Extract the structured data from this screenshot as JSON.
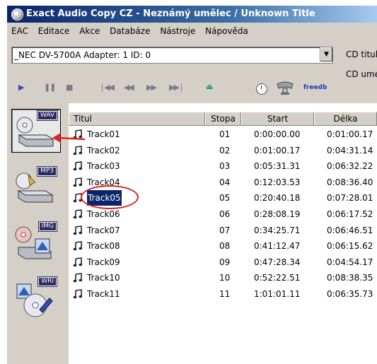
{
  "window": {
    "title": "Exact Audio Copy CZ  -  Neznámý umělec / Unknown Title",
    "icon": "cd-icon"
  },
  "menu": {
    "items": [
      "EAC",
      "Editace",
      "Akce",
      "Databáze",
      "Nástroje",
      "Nápověda"
    ]
  },
  "drive": {
    "selected": "_NEC   DV-5700A  Adapter: 1  ID: 0"
  },
  "cd_info": {
    "title_label": "CD titul",
    "artist_label": "CD ume"
  },
  "toolbar": {
    "buttons": [
      "play-icon",
      "pause-icon",
      "stop-icon",
      "skip-back-icon",
      "rewind-icon",
      "fast-forward-icon",
      "skip-forward-icon",
      "eject-icon",
      "clock-icon",
      "network-drive-icon",
      "freedb-icon"
    ],
    "freedb_label": "freedb"
  },
  "left_panel": {
    "buttons": [
      {
        "label": "WAV",
        "icon": "cd-to-hdd-wav-icon",
        "active": true
      },
      {
        "label": "MP3",
        "icon": "cd-to-hdd-mp3-icon",
        "active": false
      },
      {
        "label": "IMG",
        "icon": "cd-image-icon",
        "active": false
      },
      {
        "label": "WRI",
        "icon": "cd-write-icon",
        "active": false
      }
    ]
  },
  "table": {
    "columns": [
      "Titul",
      "Stopa",
      "Start",
      "Délka"
    ],
    "rows": [
      {
        "title": "Track01",
        "track": "01",
        "start": "0:00:00.00",
        "length": "0:01:00.17"
      },
      {
        "title": "Track02",
        "track": "02",
        "start": "0:01:00.17",
        "length": "0:04:31.14"
      },
      {
        "title": "Track03",
        "track": "03",
        "start": "0:05:31.31",
        "length": "0:06:32.22"
      },
      {
        "title": "Track04",
        "track": "04",
        "start": "0:12:03.53",
        "length": "0:08:36.40"
      },
      {
        "title": "Track05",
        "track": "05",
        "start": "0:20:40.18",
        "length": "0:07:28.01"
      },
      {
        "title": "Track06",
        "track": "06",
        "start": "0:28:08.19",
        "length": "0:06:17.52"
      },
      {
        "title": "Track07",
        "track": "07",
        "start": "0:34:25.71",
        "length": "0:06:46.51"
      },
      {
        "title": "Track08",
        "track": "08",
        "start": "0:41:12.47",
        "length": "0:06:15.62"
      },
      {
        "title": "Track09",
        "track": "09",
        "start": "0:47:28.34",
        "length": "0:04:54.17"
      },
      {
        "title": "Track10",
        "track": "10",
        "start": "0:52:22.51",
        "length": "0:08:38.35"
      },
      {
        "title": "Track11",
        "track": "11",
        "start": "1:01:01.11",
        "length": "0:06:35.73"
      }
    ],
    "selected_row": 4
  },
  "colors": {
    "titlebar": "#0a246a",
    "selection": "#0a246a",
    "annotation": "#dd2222",
    "face": "#d4d0c8"
  }
}
